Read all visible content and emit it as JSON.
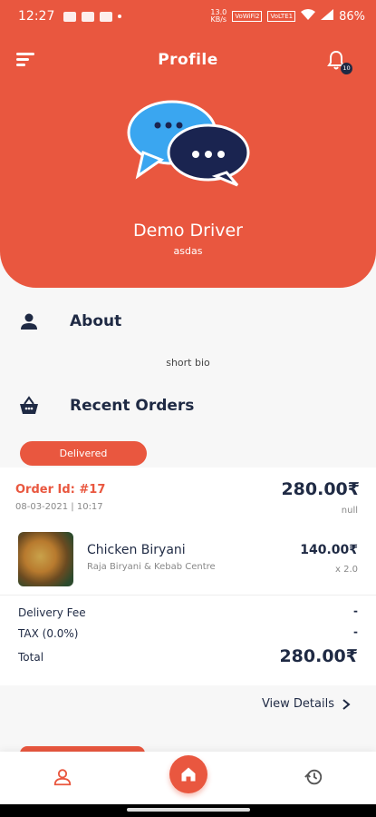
{
  "status_bar": {
    "time": "12:27",
    "network_speed": "13.0 KB/s",
    "sim1": "VoWiFi2",
    "sim2": "VoLTE1",
    "battery": "86%"
  },
  "header": {
    "title": "Profile",
    "notification_count": "10"
  },
  "profile": {
    "name": "Demo Driver",
    "subtitle": "asdas"
  },
  "about": {
    "title": "About",
    "bio": "short bio"
  },
  "recent_orders": {
    "title": "Recent Orders"
  },
  "order": {
    "status": "Delivered",
    "id": "Order Id: #17",
    "date": "08-03-2021 | 10:17",
    "total": "280.00₹",
    "total_sub": "null",
    "item": {
      "name": "Chicken Biryani",
      "restaurant": "Raja Biryani & Kebab Centre",
      "price": "140.00₹",
      "qty": "x 2.0"
    },
    "delivery_fee_label": "Delivery Fee",
    "delivery_fee_value": "-",
    "tax_label": "TAX (0.0%)",
    "tax_value": "-",
    "total_label": "Total",
    "grand_total": "280.00₹"
  },
  "view_details": "View Details",
  "colors": {
    "primary": "#e9573f",
    "navy": "#1f2a44"
  },
  "icons": [
    "menu-icon",
    "bell-icon",
    "chat-bubbles-icon",
    "person-icon",
    "basket-icon",
    "chevron-right-icon",
    "home-icon",
    "history-icon"
  ]
}
